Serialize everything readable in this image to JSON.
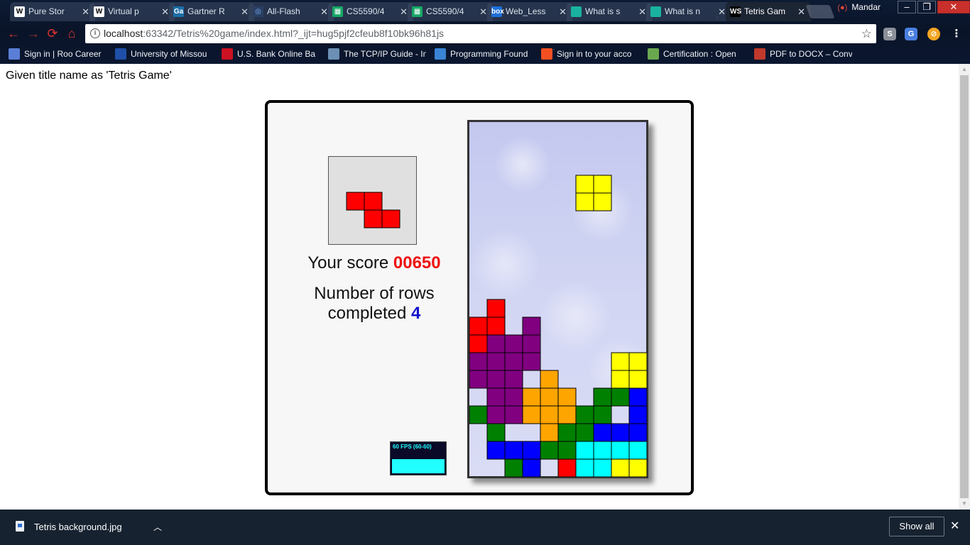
{
  "browser": {
    "tabs": [
      {
        "icon": "W",
        "icon_bg": "#ffffff",
        "icon_fg": "#000000",
        "label": "Pure Stor"
      },
      {
        "icon": "W",
        "icon_bg": "#ffffff",
        "icon_fg": "#000000",
        "label": "Virtual p"
      },
      {
        "icon": "Ga",
        "icon_bg": "#1b6ea8",
        "icon_fg": "#ffffff",
        "label": "Gartner R"
      },
      {
        "icon": "◎",
        "icon_bg": "#2a3f63",
        "icon_fg": "#7fb2ff",
        "label": "All-Flash"
      },
      {
        "icon": "▦",
        "icon_bg": "#16a765",
        "icon_fg": "#ffffff",
        "label": "CS5590/4"
      },
      {
        "icon": "▦",
        "icon_bg": "#16a765",
        "icon_fg": "#ffffff",
        "label": "CS5590/4"
      },
      {
        "icon": "box",
        "icon_bg": "#1e6fd9",
        "icon_fg": "#ffffff",
        "label": "Web_Less"
      },
      {
        "icon": "",
        "icon_bg": "#19b2a0",
        "icon_fg": "#ffffff",
        "label": "What is s"
      },
      {
        "icon": "",
        "icon_bg": "#19b2a0",
        "icon_fg": "#ffffff",
        "label": "What is n"
      },
      {
        "icon": "WS",
        "icon_bg": "#000000",
        "icon_fg": "#ffffff",
        "label": "Tetris Gam",
        "active": true
      }
    ],
    "user_name": "Mandar",
    "url_host": "localhost",
    "url_rest": ":63342/Tetris%20game/index.html?_ijt=hug5pjf2cfeub8f10bk96h81js",
    "bookmarks": [
      {
        "label": "Sign in | Roo Career",
        "color": "#5b7fd6"
      },
      {
        "label": "University of Missou",
        "color": "#1f4fa8"
      },
      {
        "label": "U.S. Bank Online Ba",
        "color": "#cc1122"
      },
      {
        "label": "The TCP/IP Guide - In",
        "color": "#6c8fb5"
      },
      {
        "label": "Programming Found",
        "color": "#3a84d6"
      },
      {
        "label": "Sign in to your acco",
        "color": "#f25022"
      },
      {
        "label": "Certification : Open",
        "color": "#6aa84f"
      },
      {
        "label": "PDF to DOCX – Conv",
        "color": "#c0392b"
      }
    ]
  },
  "page": {
    "heading": "Given title name as 'Tetris Game'",
    "score_label": "Your score",
    "score_value": "00650",
    "rows_label_line1": "Number of rows",
    "rows_label_line2": "completed",
    "rows_value": "4",
    "fps_text": "60 FPS (60-60)"
  },
  "game": {
    "cols": 10,
    "rows": 20,
    "colors": {
      "R": "#ff0000",
      "P": "#800080",
      "O": "#ffa500",
      "G": "#008000",
      "B": "#0000ff",
      "C": "#00ffff",
      "Y": "#ffff00"
    },
    "grid": [
      "..........",
      "..........",
      "..........",
      "..........",
      "..........",
      "..........",
      "..........",
      "..........",
      "..........",
      "..........",
      ".R........",
      "RR.P......",
      "RPPP......",
      "PPPP....YY",
      "PPP.O...YY",
      ".PPOOO.GGB",
      "GPPOOOGG.B",
      ".G..OGGBBB",
      ".BBBGGCCCC",
      "..GB.RCCYY"
    ],
    "falling_piece": {
      "color": "Y",
      "cells": [
        [
          6,
          3
        ],
        [
          7,
          3
        ],
        [
          6,
          4
        ],
        [
          7,
          4
        ]
      ]
    },
    "next_piece": {
      "color": "R",
      "cells": [
        [
          0,
          0
        ],
        [
          1,
          0
        ],
        [
          1,
          1
        ],
        [
          2,
          1
        ]
      ]
    }
  },
  "downloads": {
    "file_name": "Tetris background.jpg",
    "show_all_label": "Show all"
  }
}
